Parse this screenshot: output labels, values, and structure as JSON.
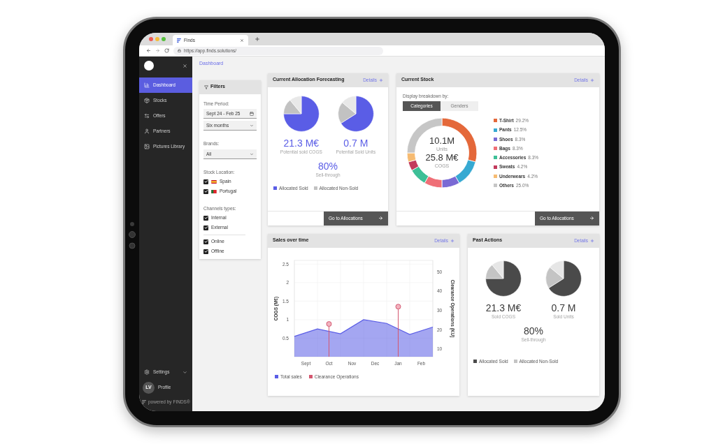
{
  "browser": {
    "tab_title": "Finds",
    "url": "https://app.finds.solutions/"
  },
  "sidebar": {
    "items": [
      {
        "label": "Dashboard",
        "selected": true
      },
      {
        "label": "Stocks",
        "selected": false
      },
      {
        "label": "Offers",
        "selected": false
      },
      {
        "label": "Partners",
        "selected": false
      },
      {
        "label": "Pictures Library",
        "selected": false
      }
    ],
    "settings": {
      "label": "Settings"
    },
    "profile": {
      "initials": "LV",
      "label": "Profile"
    },
    "footer": "powered by FINDS®"
  },
  "breadcrumb": "Dashboard",
  "filters": {
    "title": "Filters",
    "time_period": {
      "label": "Time Period:",
      "date_range": "Sept 24 - Feb 25",
      "period": "Six months"
    },
    "brands": {
      "label": "Brands:",
      "value": "All"
    },
    "stock_location": {
      "label": "Stock Location:",
      "options": [
        {
          "label": "Spain",
          "checked": true
        },
        {
          "label": "Portugal",
          "checked": true
        }
      ]
    },
    "channel_types": {
      "label": "Channels types:",
      "groups": [
        {
          "options": [
            {
              "label": "Internal",
              "checked": true
            },
            {
              "label": "External",
              "checked": true
            }
          ]
        },
        {
          "options": [
            {
              "label": "Online",
              "checked": true
            },
            {
              "label": "Offline",
              "checked": true
            }
          ]
        }
      ]
    }
  },
  "allocation": {
    "title": "Current Allocation Forecasting",
    "details": "Details",
    "metrics": [
      {
        "value": "21.3 M€",
        "label": "Potential sold COGS"
      },
      {
        "value": "0.7 M",
        "label": "Potential Sold Units"
      }
    ],
    "sell_through": {
      "value": "80%",
      "label": "Sell-through"
    },
    "legend": [
      {
        "label": "Allocated Sold",
        "color": "#5a5de6"
      },
      {
        "label": "Allocated Non-Sold",
        "color": "#c2c2c2"
      }
    ],
    "button": "Go to Allocations"
  },
  "stock": {
    "title": "Current Stock",
    "details": "Details",
    "breakdown_label": "Display breakdown by:",
    "tabs": [
      {
        "label": "Categories",
        "selected": true
      },
      {
        "label": "Genders",
        "selected": false
      }
    ],
    "center": [
      {
        "value": "10.1M",
        "label": "Units"
      },
      {
        "value": "25.8 M€",
        "label": "COGS"
      }
    ],
    "chart_data": {
      "type": "donut",
      "categories": [
        "T-Shirt",
        "Pants",
        "Shoes",
        "Bags",
        "Accessories",
        "Sweats",
        "Underwears",
        "Others"
      ],
      "values": [
        29.2,
        12.5,
        8.3,
        8.3,
        8.3,
        4.2,
        4.2,
        25.0
      ]
    },
    "legend": [
      {
        "value": "29.2%",
        "color": "#e4683a"
      },
      {
        "value": "12.5%",
        "color": "#36a9d2"
      },
      {
        "value": "8.3%",
        "color": "#7a6ad4"
      },
      {
        "value": "8.3%",
        "color": "#ef6f77"
      },
      {
        "value": "8.3%",
        "color": "#3dbf97"
      },
      {
        "value": "4.2%",
        "color": "#c23a5c"
      },
      {
        "value": "4.2%",
        "color": "#f6bb72"
      },
      {
        "value": "25.0%",
        "color": "#c6c6c6"
      }
    ],
    "button": "Go to Allocations"
  },
  "sales": {
    "title": "Sales over time",
    "details": "Details",
    "chart_data": {
      "type": "area",
      "ylabel": "COGS (M€)",
      "y2label": "Clearance Operations (KU)",
      "categories": [
        null,
        "Sept",
        null,
        "Oct",
        null,
        "Nov",
        null,
        "Dec",
        null,
        "Jan",
        null,
        "Feb",
        null
      ],
      "ylim": [
        0,
        2.6
      ],
      "yticks": [
        0.5,
        1,
        1.5,
        2,
        2.5
      ],
      "y2lim": [
        6,
        56
      ],
      "y2ticks": [
        10,
        20,
        30,
        40,
        50
      ],
      "grid": true,
      "series": [
        {
          "name": "Total sales",
          "color": "#5a5de6",
          "values": [
            0.55,
            null,
            0.75,
            null,
            0.62,
            null,
            1.0,
            null,
            0.9,
            null,
            0.6,
            null,
            0.8
          ]
        },
        {
          "name": "Clearance Operations",
          "color": "#d4566f",
          "type": "scatter",
          "axis": "y2",
          "values": [
            null,
            null,
            null,
            23,
            null,
            null,
            null,
            null,
            null,
            32,
            null,
            null,
            null
          ]
        }
      ]
    }
  },
  "past_actions": {
    "title": "Past Actions",
    "details": "Details",
    "metrics": [
      {
        "value": "21.3 M€",
        "label": "Sold COGS"
      },
      {
        "value": "0.7 M",
        "label": "Sold Units"
      }
    ],
    "sell_through": {
      "value": "80%",
      "label": "Sell-through"
    },
    "legend": [
      {
        "label": "Allocated Sold",
        "color": "#4a4a4a"
      },
      {
        "label": "Allocated Non-Sold",
        "color": "#c4c4c4"
      }
    ]
  }
}
